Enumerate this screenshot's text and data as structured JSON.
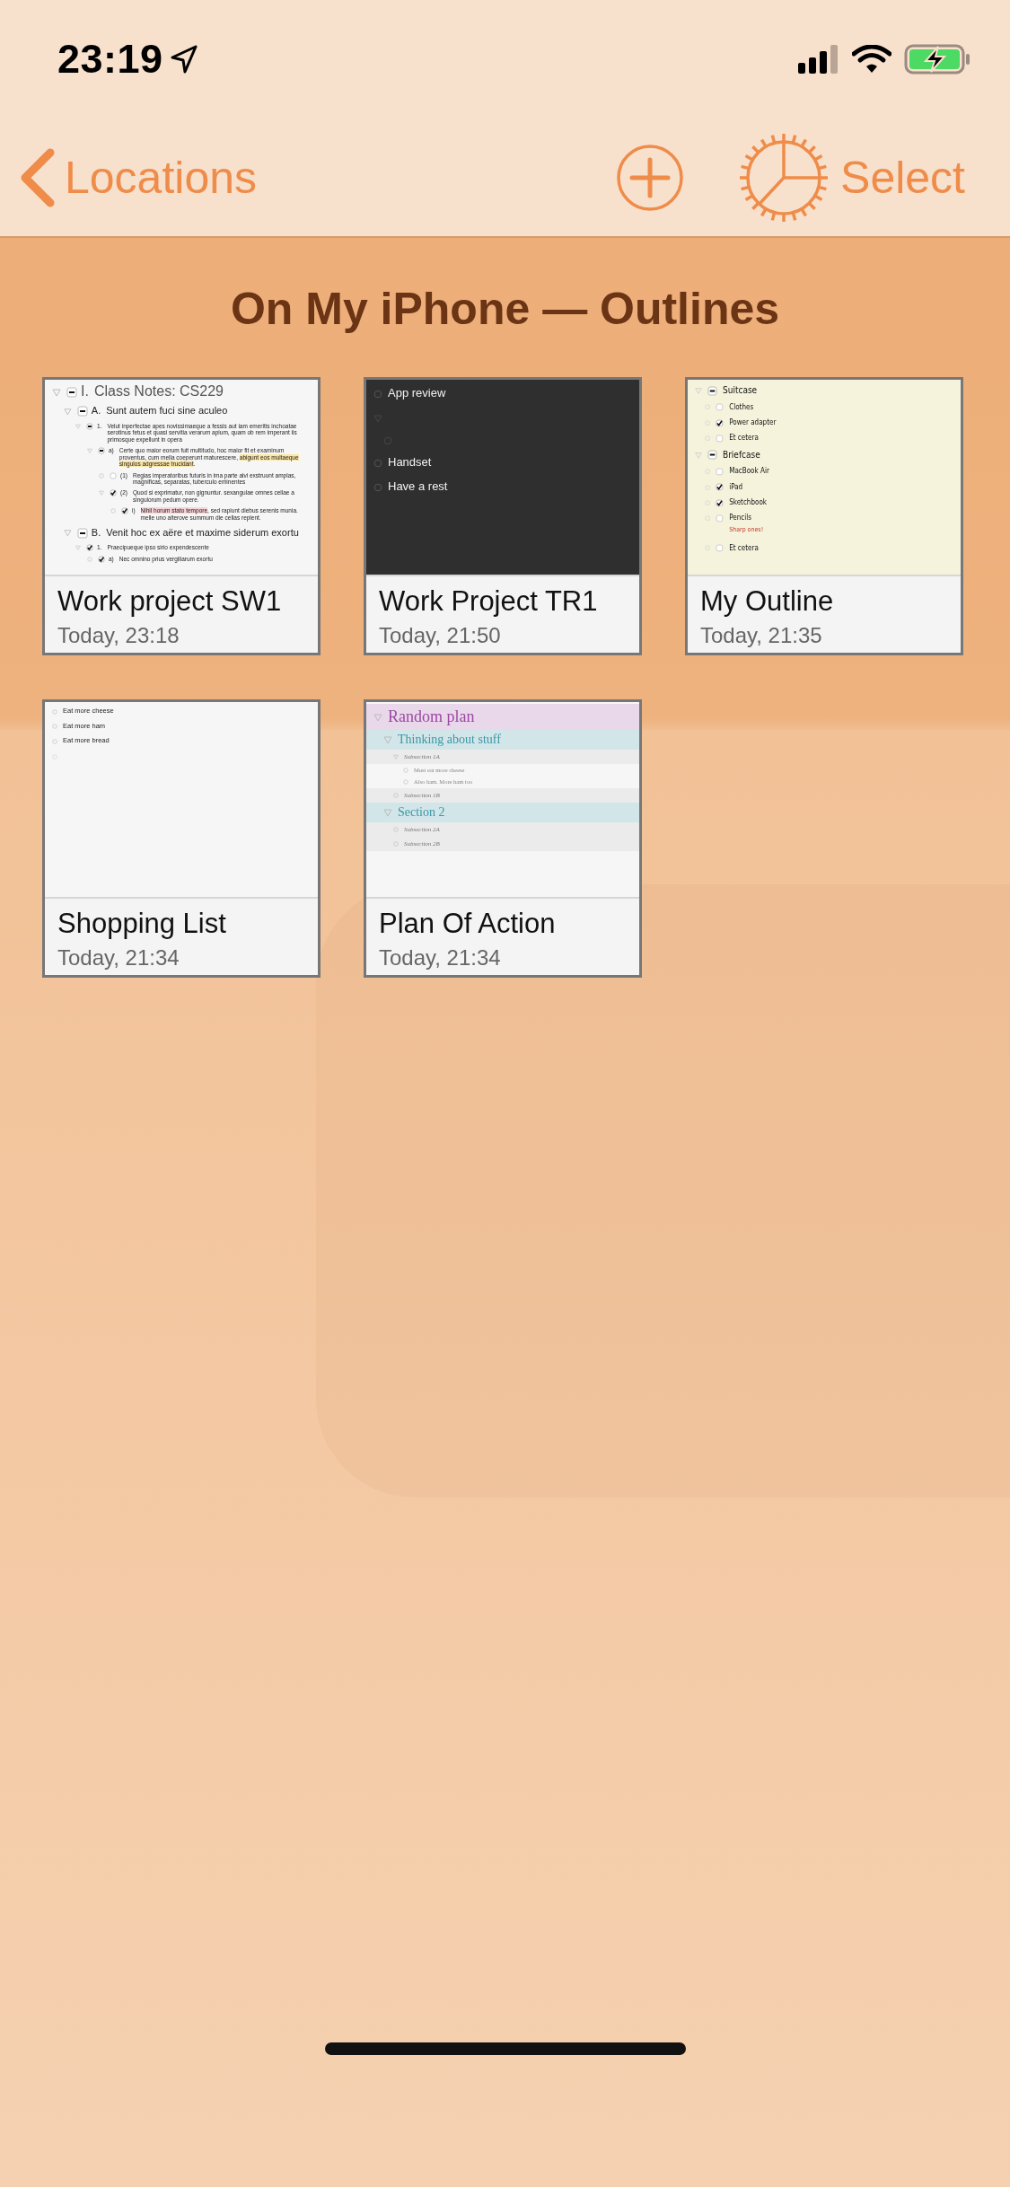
{
  "status_bar": {
    "time": "23:19"
  },
  "nav": {
    "back": "Locations",
    "action": "Select"
  },
  "title": "On My iPhone — Outlines",
  "documents": [
    {
      "name": "Work project SW1",
      "date": "Today, 23:18",
      "preview": {
        "kind": "plain",
        "rows": [
          {
            "label": "I.",
            "indeterminate": true,
            "text": "Class Notes: CS229",
            "children": [
              {
                "label": "A.",
                "indeterminate": true,
                "text": "Sunt autem fuci sine aculeo",
                "children": [
                  {
                    "label": "1.",
                    "indeterminate": true,
                    "text": "Velut inperfectae apes novissimaeque a fessis aut iam emeritis inchoatae serotinus fetus et quasi servitia verarum apium, quam ob rem imperant iis primosque expellunt in opera",
                    "children": [
                      {
                        "label": "a)",
                        "indeterminate": true,
                        "parts": [
                          {
                            "text": "Certe quo maior eorum fuit multitudo, hoc maior fit et examinum proventus, cum mella coeperunt maturescere, "
                          },
                          {
                            "text": "abigunt eos multaeque singulos adgressae trucidant",
                            "color": "#fbe6a4"
                          },
                          {
                            "text": "."
                          }
                        ],
                        "children": [
                          {
                            "label": "(1)",
                            "checked": false,
                            "indeterminate": false,
                            "text": "Regias imperatoribus futuris in ima parte alvi exstruunt amplas, magnificas, separatas, tuberculo eminentes"
                          },
                          {
                            "label": "(2)",
                            "checked": true,
                            "indeterminate": false,
                            "text": "Quod si exprimatur, non gignuntur. sexangulae omnes cellae a singulorum pedum opere.",
                            "children": [
                              {
                                "label": "i)",
                                "checked": true,
                                "indeterminate": false,
                                "parts": [
                                  {
                                    "text": "Nihil horum stato tempore",
                                    "color": "#f8d3d8"
                                  },
                                  {
                                    "text": ", sed rapiunt diebus serenis munia. melle uno alterove summum die cellas replent."
                                  }
                                ]
                              }
                            ]
                          }
                        ]
                      }
                    ]
                  }
                ]
              },
              {
                "label": "B.",
                "indeterminate": true,
                "text": "Venit hoc ex aëre et maxime siderum exortu",
                "children": [
                  {
                    "label": "1.",
                    "checked": true,
                    "indeterminate": false,
                    "text": "Praecipueque ipso sirio expendescente",
                    "children": [
                      {
                        "label": "a)",
                        "checked": true,
                        "indeterminate": false,
                        "text": "Nec omnino prius vergiliarum exortu"
                      }
                    ]
                  }
                ]
              }
            ]
          }
        ]
      }
    },
    {
      "name": "Work Project TR1",
      "date": "Today, 21:50",
      "preview": {
        "kind": "dark",
        "rows": [
          {
            "kind": "item",
            "text": "App review"
          },
          {
            "kind": "blank",
            "children": [
              {
                "kind": "blank"
              }
            ]
          },
          {
            "kind": "item",
            "text": "Handset"
          },
          {
            "kind": "item",
            "text": "Have a rest"
          }
        ]
      }
    },
    {
      "name": "My Outline",
      "date": "Today, 21:35",
      "preview": {
        "kind": "cream",
        "rows": [
          {
            "indeterminate": true,
            "text": "Suitcase",
            "children": [
              {
                "checked": false,
                "indeterminate": false,
                "text": "Clothes"
              },
              {
                "checked": true,
                "indeterminate": false,
                "text": "Power adapter"
              },
              {
                "checked": false,
                "indeterminate": false,
                "text": "Et cetera"
              }
            ]
          },
          {
            "indeterminate": true,
            "text": "Briefcase",
            "children": [
              {
                "checked": false,
                "indeterminate": false,
                "text": "MacBook Air"
              },
              {
                "checked": true,
                "indeterminate": false,
                "text": "iPad"
              },
              {
                "checked": true,
                "indeterminate": false,
                "text": "Sketchbook"
              },
              {
                "checked": false,
                "indeterminate": false,
                "text": "Pencils",
                "note": "Sharp ones!"
              },
              {
                "checked": false,
                "indeterminate": false,
                "text": "Et cetera"
              }
            ]
          }
        ]
      }
    },
    {
      "name": "Shopping List",
      "date": "Today, 21:34",
      "preview": {
        "kind": "list",
        "rows": [
          {
            "kind": "item",
            "text": "Eat more cheese"
          },
          {
            "kind": "item",
            "text": "Eat more ham"
          },
          {
            "kind": "item",
            "text": "Eat more bread"
          },
          {
            "kind": "blank"
          }
        ]
      }
    },
    {
      "name": "Plan Of Action",
      "date": "Today, 21:34",
      "preview": {
        "kind": "colorful",
        "rows": [
          {
            "text": "Random plan",
            "children": [
              {
                "text": "Thinking about stuff",
                "children": [
                  {
                    "text": "Subsection 1A",
                    "children": [
                      {
                        "text": "Must eat more cheese"
                      },
                      {
                        "text": "Also ham. More ham too"
                      }
                    ]
                  },
                  {
                    "text": "Subsection 1B"
                  }
                ]
              },
              {
                "text": "Section 2",
                "children": [
                  {
                    "text": "Subsection 2A"
                  },
                  {
                    "text": "Subsection 2B"
                  }
                ]
              }
            ]
          }
        ]
      }
    }
  ]
}
